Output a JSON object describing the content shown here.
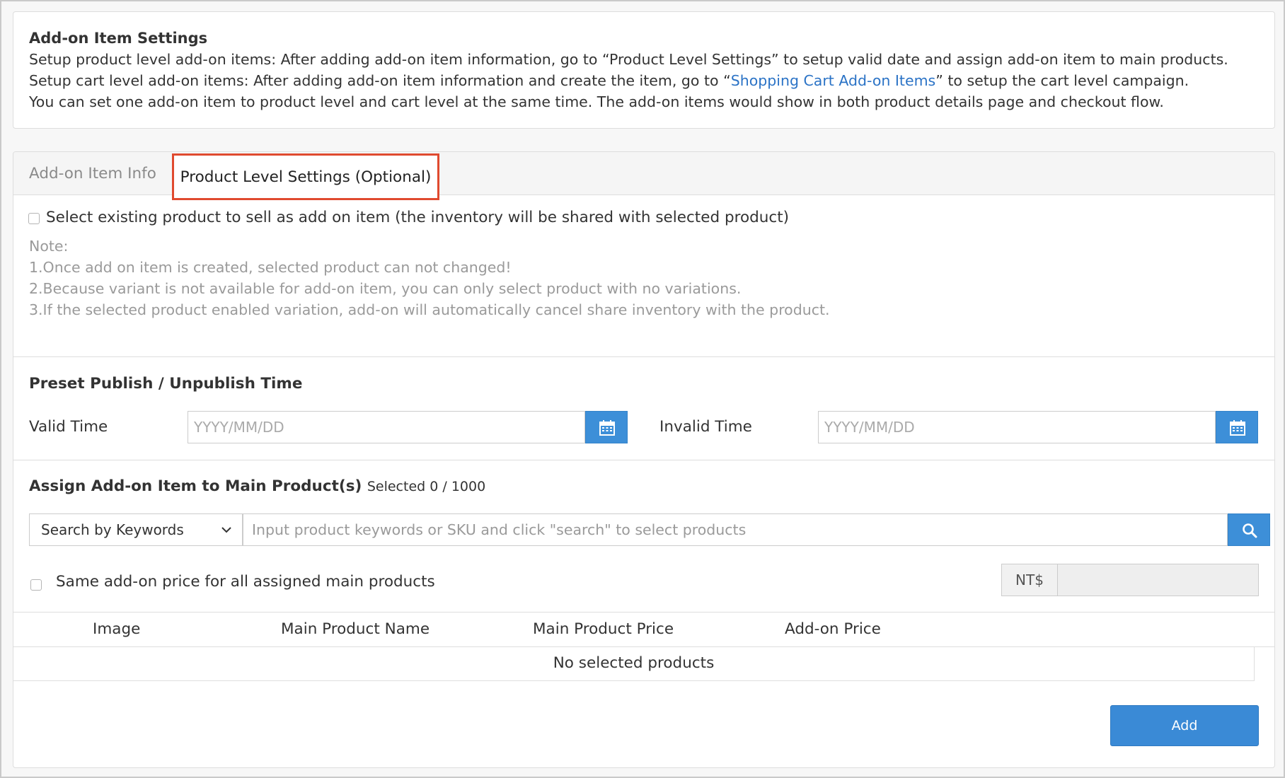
{
  "info": {
    "title": "Add-on Item Settings",
    "line1": "Setup product level add-on items: After adding add-on item information, go to “Product Level Settings” to setup valid date and assign add-on item to main products.",
    "line2_prefix": "Setup cart level add-on items: After adding add-on item information and create the item, go to “",
    "line2_link": "Shopping Cart Add-on Items",
    "line2_suffix": "” to setup the cart level campaign.",
    "line3": "You can set one add-on item to product level and cart level at the same time. The add-on items would show in both product details page and checkout flow."
  },
  "tabs": [
    {
      "label": "Add-on Item Info",
      "active": false
    },
    {
      "label": "Product Level Settings (Optional)",
      "active": true
    }
  ],
  "existing_product": {
    "checkbox_label": "Select existing product to sell as add on item (the inventory will be shared with selected product)",
    "checked": false,
    "note_title": "Note:",
    "notes": [
      "1.Once add on item is created, selected product can not changed!",
      "2.Because variant is not available for add-on item, you can only select product with no variations.",
      "3.If the selected product enabled variation, add-on will automatically cancel share inventory with the product."
    ]
  },
  "publish": {
    "title": "Preset Publish / Unpublish Time",
    "valid_label": "Valid Time",
    "valid_placeholder": "YYYY/MM/DD",
    "invalid_label": "Invalid Time",
    "invalid_placeholder": "YYYY/MM/DD"
  },
  "assign": {
    "title": "Assign Add-on Item to Main Product(s)",
    "selected_count": "Selected 0 / 1000",
    "search_mode": "Search by Keywords",
    "search_placeholder": "Input product keywords or SKU and click \"search\" to select products",
    "same_price_label": "Same add-on price for all assigned main products",
    "same_price_checked": false,
    "currency": "NT$",
    "price_value": ""
  },
  "table": {
    "columns": [
      "Image",
      "Main Product Name",
      "Main Product Price",
      "Add-on Price"
    ],
    "empty_text": "No selected products"
  },
  "actions": {
    "add_label": "Add"
  },
  "colors": {
    "accent": "#3d8fd8",
    "highlight": "#e04a2f",
    "link": "#2b73c6"
  }
}
